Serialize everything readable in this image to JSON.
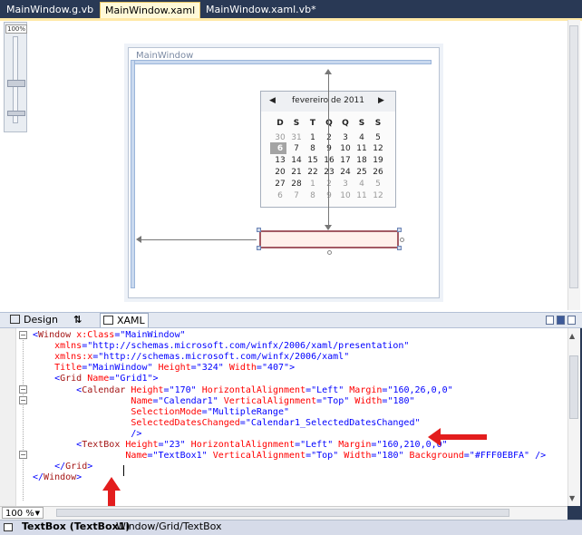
{
  "tabs": [
    {
      "label": "MainWindow.g.vb",
      "active": false
    },
    {
      "label": "MainWindow.xaml",
      "active": true
    },
    {
      "label": "MainWindow.xaml.vb*",
      "active": false
    }
  ],
  "designer": {
    "zoom_label": "100%",
    "window_title": "MainWindow",
    "calendar": {
      "month": "fevereiro de 2011",
      "prev_icon": "◀",
      "next_icon": "▶",
      "days_of_week": [
        "D",
        "S",
        "T",
        "Q",
        "Q",
        "S",
        "S"
      ],
      "weeks": [
        [
          "30",
          "31",
          "1",
          "2",
          "3",
          "4",
          "5"
        ],
        [
          "6",
          "7",
          "8",
          "9",
          "10",
          "11",
          "12"
        ],
        [
          "13",
          "14",
          "15",
          "16",
          "17",
          "18",
          "19"
        ],
        [
          "20",
          "21",
          "22",
          "23",
          "24",
          "25",
          "26"
        ],
        [
          "27",
          "28",
          "1",
          "2",
          "3",
          "4",
          "5"
        ],
        [
          "6",
          "7",
          "8",
          "9",
          "10",
          "11",
          "12"
        ]
      ],
      "today": "6"
    },
    "textbox_background": "#FFF0EBFA"
  },
  "split_tabs": {
    "design": "Design",
    "swap": "⇅",
    "xaml": "XAML"
  },
  "code": {
    "lines": [
      "<Window x:Class=\"MainWindow\"",
      "    xmlns=\"http://schemas.microsoft.com/winfx/2006/xaml/presentation\"",
      "    xmlns:x=\"http://schemas.microsoft.com/winfx/2006/xaml\"",
      "    Title=\"MainWindow\" Height=\"324\" Width=\"407\">",
      "    <Grid Name=\"Grid1\">",
      "        <Calendar Height=\"170\" HorizontalAlignment=\"Left\" Margin=\"160,26,0,0\"",
      "                  Name=\"Calendar1\" VerticalAlignment=\"Top\" Width=\"180\"",
      "                  SelectionMode=\"MultipleRange\"",
      "                  SelectedDatesChanged=\"Calendar1_SelectedDatesChanged\"",
      "                  />",
      "        <TextBox Height=\"23\" HorizontalAlignment=\"Left\" Margin=\"160,210,0,0\"",
      "                 Name=\"TextBox1\" VerticalAlignment=\"Top\" Width=\"180\" Background=\"#FFF0EBFA\" />",
      "    </Grid>",
      "</Window>"
    ]
  },
  "zoom": "100 %",
  "status": {
    "element": "TextBox (TextBox1)",
    "path": "Window/Grid/TextBox"
  },
  "colors": {
    "annotation_arrow": "#e31d1d",
    "textbox_fill": "#fff0eb",
    "tab_bar": "#293955"
  }
}
